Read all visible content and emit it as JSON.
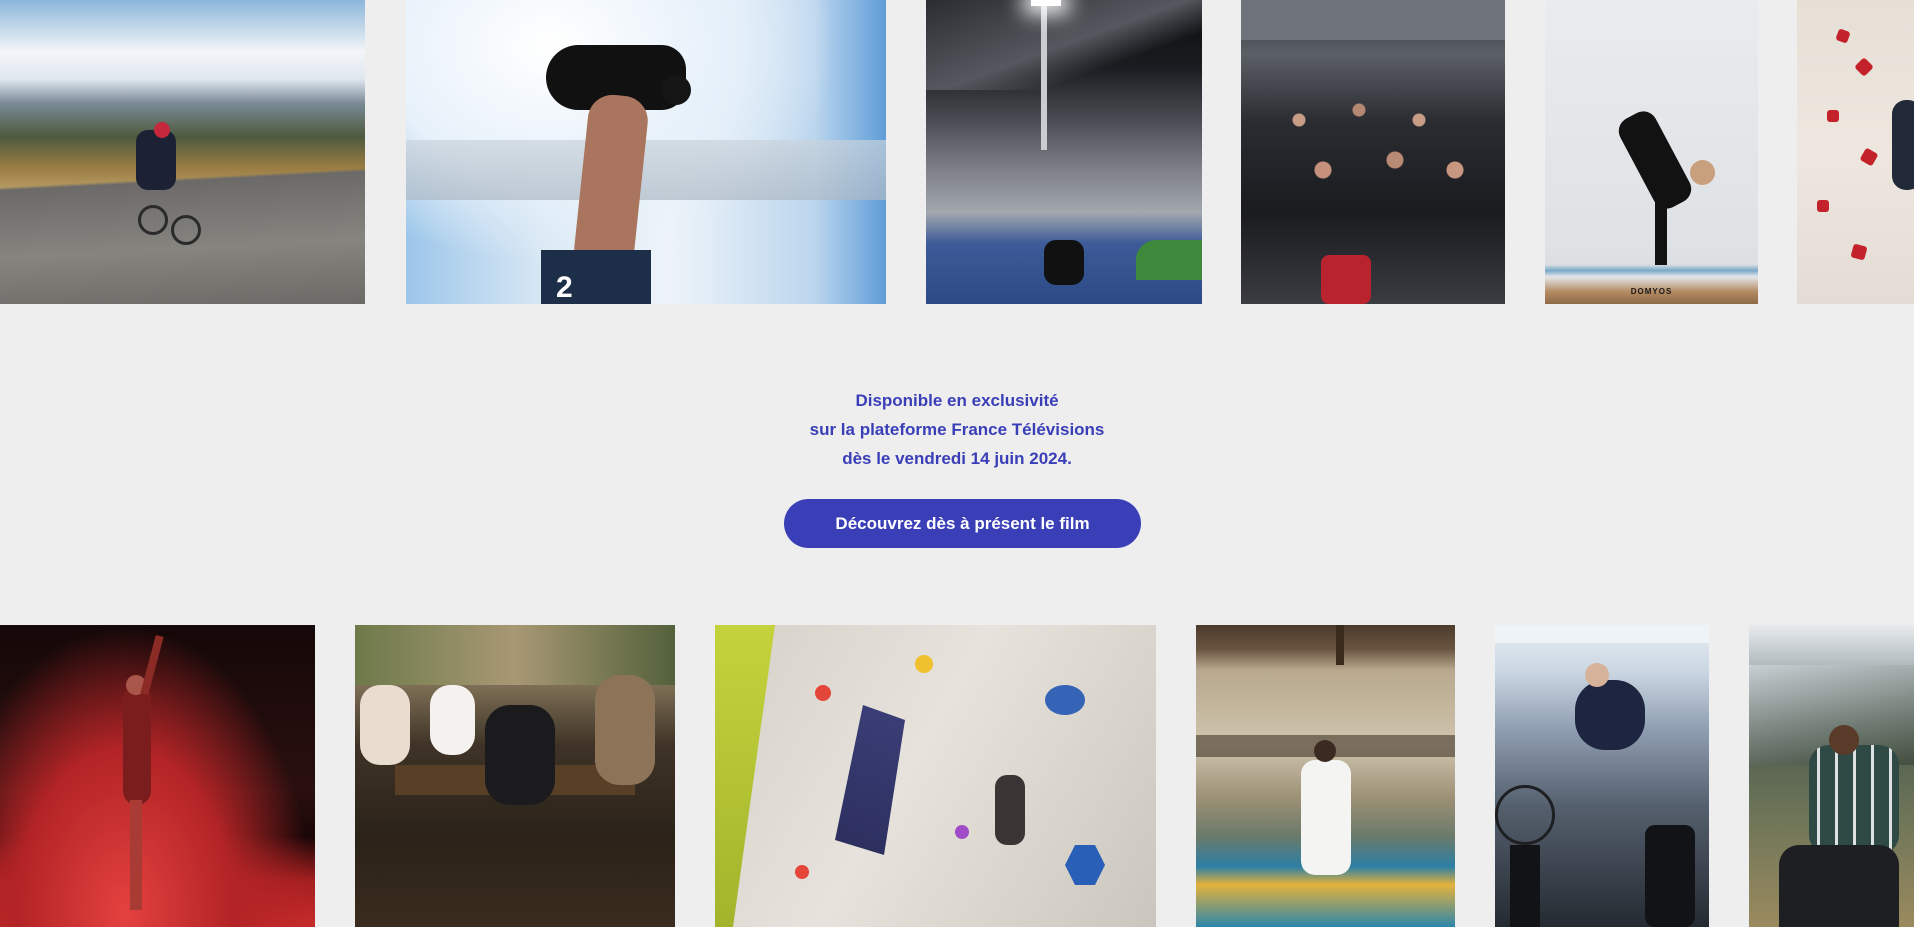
{
  "promo": {
    "line1": "Disponible en exclusivité",
    "line2": "sur la plateforme France Télévisions",
    "line3": "dès le vendredi 14 juin 2024."
  },
  "cta": {
    "label": "Découvrez dès à présent le film"
  },
  "colors": {
    "accent": "#3a3fb8",
    "background": "#eeeeee"
  },
  "gallery_top": [
    {
      "name": "cyclist-photo"
    },
    {
      "name": "swimmer-photo"
    },
    {
      "name": "stadium-photo"
    },
    {
      "name": "team-photo"
    },
    {
      "name": "dancer-photo",
      "caption": "DOMYOS"
    },
    {
      "name": "climbing-wall-photo"
    }
  ],
  "gallery_bottom": [
    {
      "name": "gymnast-photo"
    },
    {
      "name": "dinner-photo"
    },
    {
      "name": "climbing-gym-photo"
    },
    {
      "name": "judo-photo"
    },
    {
      "name": "indoor-cycling-photo"
    },
    {
      "name": "outdoor-portrait-photo"
    }
  ]
}
